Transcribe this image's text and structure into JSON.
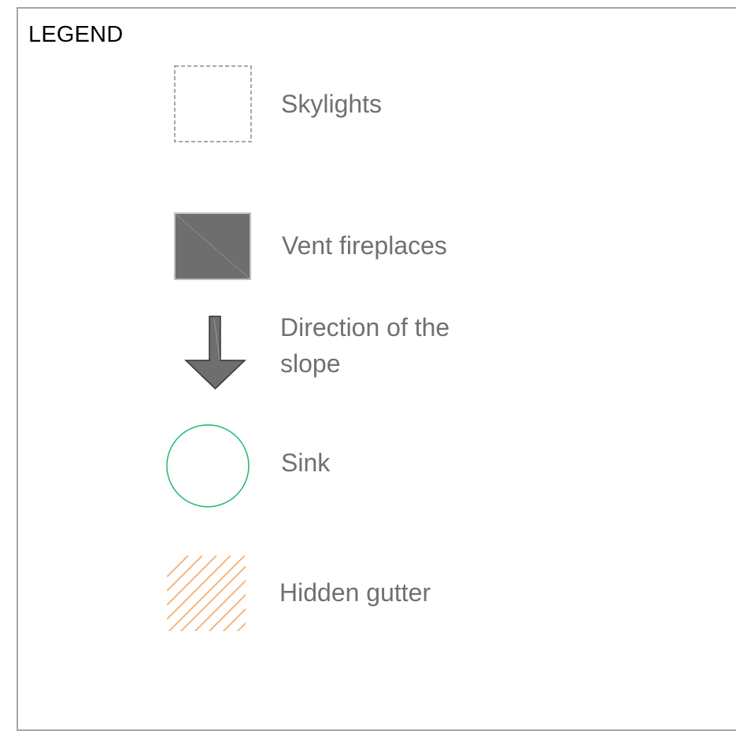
{
  "legend": {
    "title": "LEGEND",
    "items": [
      {
        "id": "skylights",
        "label": "Skylights",
        "icon": "dashed-square-icon",
        "stroke_color": "#8c8c8c"
      },
      {
        "id": "vent-fireplaces",
        "label": "Vent fireplaces",
        "icon": "split-filled-square-icon",
        "fill_color": "#6e6e6e"
      },
      {
        "id": "slope-direction",
        "label_lines": [
          "Direction of the",
          "slope"
        ],
        "icon": "down-arrow-icon",
        "fill_color": "#6e6e6e"
      },
      {
        "id": "sink",
        "label": "Sink",
        "icon": "circle-icon",
        "stroke_color": "#1fb86a"
      },
      {
        "id": "hidden-gutter",
        "label": "Hidden gutter",
        "icon": "diagonal-hatch-icon",
        "stroke_color": "#f5b06e"
      }
    ]
  }
}
